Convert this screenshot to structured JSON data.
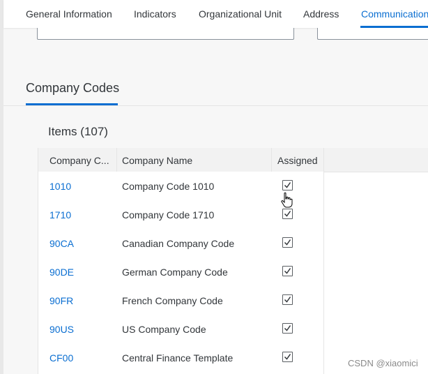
{
  "tabs": [
    {
      "label": "General Information",
      "selected": false
    },
    {
      "label": "Indicators",
      "selected": false
    },
    {
      "label": "Organizational Unit",
      "selected": false
    },
    {
      "label": "Address",
      "selected": false
    },
    {
      "label": "Communication",
      "selected": true
    }
  ],
  "section": {
    "title": "Company Codes",
    "items_title": "Items (107)"
  },
  "table": {
    "columns": [
      "Company C...",
      "Company Name",
      "Assigned"
    ],
    "rows": [
      {
        "code": "1010",
        "name": "Company Code 1010",
        "assigned": true
      },
      {
        "code": "1710",
        "name": "Company Code 1710",
        "assigned": true
      },
      {
        "code": "90CA",
        "name": "Canadian Company Code",
        "assigned": true
      },
      {
        "code": "90DE",
        "name": "German Company Code",
        "assigned": true
      },
      {
        "code": "90FR",
        "name": "French Company Code",
        "assigned": true
      },
      {
        "code": "90US",
        "name": "US Company Code",
        "assigned": true
      },
      {
        "code": "CF00",
        "name": "Central Finance Template",
        "assigned": true
      }
    ]
  },
  "watermark": "CSDN @xiaomici",
  "colors": {
    "accent": "#0a6ed1",
    "text": "#32363a",
    "header_bg": "#f2f2f2"
  },
  "icons": {
    "checkbox": "check-icon",
    "pointer": "hand-cursor-icon"
  }
}
